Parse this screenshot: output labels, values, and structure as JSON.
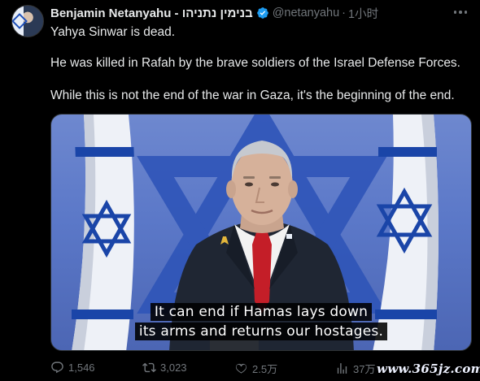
{
  "author": {
    "name": "Benjamin Netanyahu - בנימין נתניהו",
    "handle": "@netanyahu",
    "separator": "·",
    "time": "1小时"
  },
  "body": {
    "line1": "Yahya Sinwar is dead.",
    "line2": "He was killed in Rafah by the brave soldiers of the Israel Defense Forces.",
    "line3": "While this is not the end of the war in Gaza, it's the beginning of the end."
  },
  "media": {
    "caption_line1": "It can end if Hamas lays down",
    "caption_line2": "its arms and returns our hostages."
  },
  "stats": {
    "replies": "1,546",
    "retweets": "3,023",
    "likes": "2.5万",
    "views": "37万"
  },
  "watermark": "www.365jz.com",
  "colors": {
    "background": "#000000",
    "text": "#e7e9ea",
    "muted": "#71767b",
    "verified": "#1d9bf0",
    "flag_blue": "#1a45a8"
  },
  "icons": [
    "verified-badge-icon",
    "more-icon",
    "reply-icon",
    "retweet-icon",
    "like-icon",
    "views-icon"
  ]
}
